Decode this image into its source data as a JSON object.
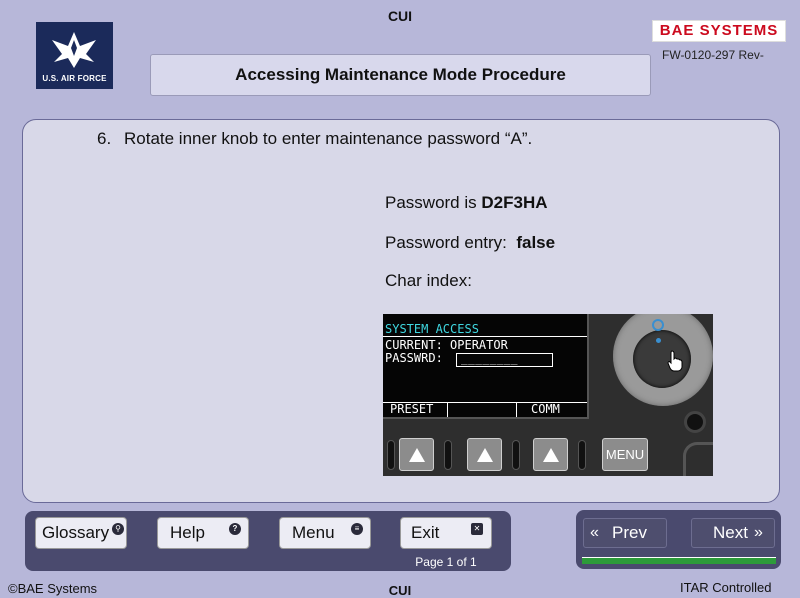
{
  "header": {
    "classification": "CUI",
    "logo_text": "U.S. AIR FORCE",
    "brand": "BAE SYSTEMS",
    "doc_number": "FW-0120-297 Rev-",
    "title": "Accessing Maintenance Mode Procedure"
  },
  "main": {
    "step_number": "6.",
    "step_text": "Rotate inner knob to enter maintenance password “A”.",
    "password_label": "Password is",
    "password_value": "D2F3HA",
    "entry_label": "Password entry:",
    "entry_value": "false",
    "char_index_label": "Char index:"
  },
  "device": {
    "screen_title": "SYSTEM ACCESS",
    "current_line": "CURRENT: OPERATOR",
    "passwd_label": "PASSWRD:",
    "passwd_field": "________",
    "softkey_1": "PRESET",
    "softkey_3": "COMM",
    "menu_button": "MENU"
  },
  "nav": {
    "glossary": "Glossary",
    "help": "Help",
    "menu": "Menu",
    "exit": "Exit",
    "page_info": "Page 1 of 1",
    "prev": "Prev",
    "next": "Next",
    "progress_fraction": 1.0
  },
  "footer": {
    "copyright": "©BAE Systems",
    "classification": "CUI",
    "itar": "ITAR Controlled"
  },
  "icons": {
    "glossary": "search-icon",
    "help": "question-icon",
    "menu": "list-icon",
    "exit": "close-icon",
    "prev": "double-chevron-left-icon",
    "next": "double-chevron-right-icon"
  },
  "colors": {
    "brand_red": "#cc0a1e",
    "screen_title": "#3fd7e0",
    "progress": "#2d9a3a"
  }
}
